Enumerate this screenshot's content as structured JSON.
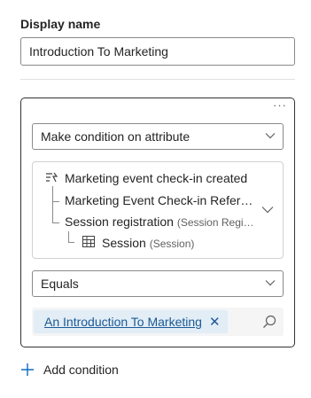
{
  "display_name": {
    "label": "Display name",
    "value": "Introduction To Marketing"
  },
  "condition": {
    "more_glyph": "···",
    "attribute_select": "Make condition on attribute",
    "path": [
      {
        "label": "Marketing event check-in created",
        "sub": ""
      },
      {
        "label": "Marketing Event Check-in Refer…",
        "sub": ""
      },
      {
        "label": "Session registration",
        "sub": "(Session Regi…"
      },
      {
        "label": "Session",
        "sub": "(Session)"
      }
    ],
    "operator_select": "Equals",
    "value_chip": "An Introduction To Marketing",
    "chip_remove_glyph": "✕"
  },
  "add_condition": {
    "label": "Add condition"
  },
  "colors": {
    "accent": "#0f6cbd",
    "chip_bg": "#e2edf6",
    "chip_text": "#1c5a96"
  }
}
